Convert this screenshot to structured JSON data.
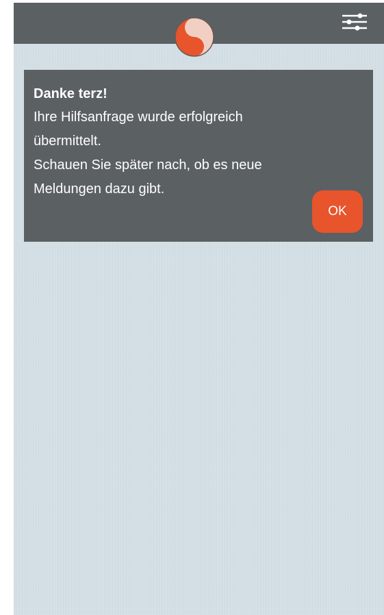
{
  "app": {
    "logo_icon": "terz-logo-icon",
    "menu_icon": "settings-sliders-icon"
  },
  "dialog": {
    "title": "Danke terz!",
    "lines": [
      "Ihre Hilfsanfrage wurde erfolgreich",
      "übermittelt.",
      "Schauen Sie später nach, ob es neue",
      "Meldungen dazu gibt."
    ],
    "ok_label": "OK"
  },
  "colors": {
    "topbar": "#5b6063",
    "dialog_bg": "#5b6063",
    "accent": "#e8542c",
    "background": "#d3dee5",
    "logo_light": "#f1d0c3"
  }
}
